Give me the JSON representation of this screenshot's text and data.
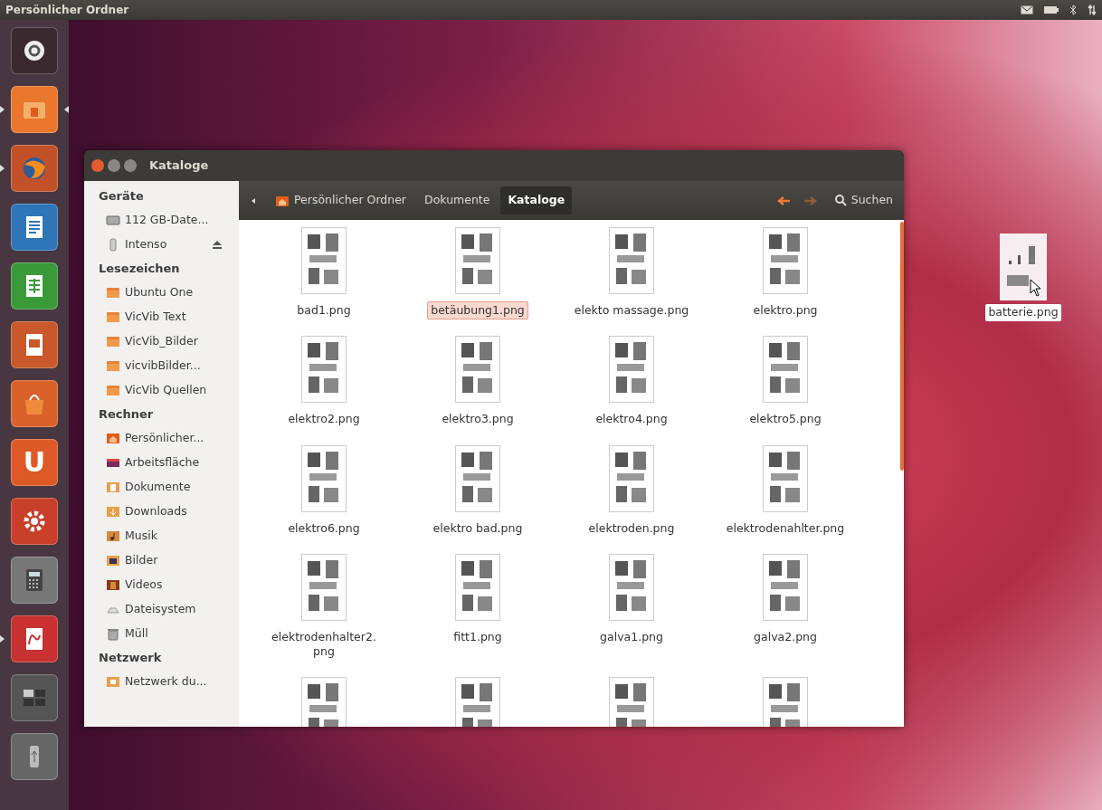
{
  "panel": {
    "title": "Persönlicher Ordner"
  },
  "launcher": [
    {
      "kind": "dash",
      "running": false,
      "focused": false
    },
    {
      "kind": "folder",
      "running": true,
      "focused": true
    },
    {
      "kind": "browser",
      "running": true,
      "focused": false
    },
    {
      "kind": "writer",
      "running": false,
      "focused": false
    },
    {
      "kind": "spreadsheet",
      "running": false,
      "focused": false
    },
    {
      "kind": "presentation",
      "running": false,
      "focused": false
    },
    {
      "kind": "bag",
      "running": false,
      "focused": false
    },
    {
      "kind": "letter",
      "glyph": "U",
      "running": false,
      "focused": false
    },
    {
      "kind": "gear",
      "running": false,
      "focused": false
    },
    {
      "kind": "calculator",
      "running": false,
      "focused": false
    },
    {
      "kind": "pdf",
      "running": true,
      "focused": false
    },
    {
      "kind": "workspaces",
      "running": false,
      "focused": false
    },
    {
      "kind": "usb",
      "running": false,
      "focused": false
    }
  ],
  "window": {
    "title": "Kataloge",
    "sidebar": [
      {
        "heading": "Geräte",
        "items": [
          {
            "label": "112 GB-Date...",
            "kind": "drive",
            "eject": false
          },
          {
            "label": "Intenso",
            "kind": "usb",
            "eject": true
          }
        ]
      },
      {
        "heading": "Lesezeichen",
        "items": [
          {
            "label": "Ubuntu One",
            "kind": "folder"
          },
          {
            "label": "VicVib Text",
            "kind": "folder"
          },
          {
            "label": "VicVib_Bilder",
            "kind": "folder"
          },
          {
            "label": "vicvibBilder...",
            "kind": "folder"
          },
          {
            "label": "VicVib Quellen",
            "kind": "folder"
          }
        ]
      },
      {
        "heading": "Rechner",
        "items": [
          {
            "label": "Persönlicher...",
            "kind": "home"
          },
          {
            "label": "Arbeitsfläche",
            "kind": "desktop"
          },
          {
            "label": "Dokumente",
            "kind": "documents"
          },
          {
            "label": "Downloads",
            "kind": "downloads"
          },
          {
            "label": "Musik",
            "kind": "music"
          },
          {
            "label": "Bilder",
            "kind": "pictures"
          },
          {
            "label": "Videos",
            "kind": "videos"
          },
          {
            "label": "Dateisystem",
            "kind": "filesystem"
          },
          {
            "label": "Müll",
            "kind": "trash"
          }
        ]
      },
      {
        "heading": "Netzwerk",
        "items": [
          {
            "label": "Netzwerk du...",
            "kind": "network"
          }
        ]
      }
    ],
    "breadcrumbs": [
      {
        "label": "Persönlicher Ordner",
        "home": true,
        "selected": false
      },
      {
        "label": "Dokumente",
        "home": false,
        "selected": false
      },
      {
        "label": "Kataloge",
        "home": false,
        "selected": true
      }
    ],
    "nav_buttons": [
      {
        "kind": "back",
        "disabled": false
      },
      {
        "kind": "forward",
        "disabled": true
      }
    ],
    "search": {
      "label": "Suchen"
    },
    "files": [
      {
        "name": "bad1.png",
        "selected": false
      },
      {
        "name": "betäubung1.png",
        "selected": true
      },
      {
        "name": "elekto massage.png",
        "selected": false
      },
      {
        "name": "elektro.png",
        "selected": false
      },
      {
        "name": "elektro2.png",
        "selected": false
      },
      {
        "name": "elektro3.png",
        "selected": false
      },
      {
        "name": "elektro4.png",
        "selected": false
      },
      {
        "name": "elektro5.png",
        "selected": false
      },
      {
        "name": "elektro6.png",
        "selected": false
      },
      {
        "name": "elektro bad.png",
        "selected": false
      },
      {
        "name": "elektroden.png",
        "selected": false
      },
      {
        "name": "elektrodenahlter.png",
        "selected": false
      },
      {
        "name": "elektrodenhalter2.png",
        "selected": false
      },
      {
        "name": "fitt1.png",
        "selected": false
      },
      {
        "name": "galva1.png",
        "selected": false
      },
      {
        "name": "galva2.png",
        "selected": false
      },
      {
        "selected": false
      },
      {
        "selected": false
      },
      {
        "selected": false
      },
      {
        "selected": false
      }
    ]
  },
  "desktop_icons": [
    {
      "name": "batterie.png"
    }
  ]
}
